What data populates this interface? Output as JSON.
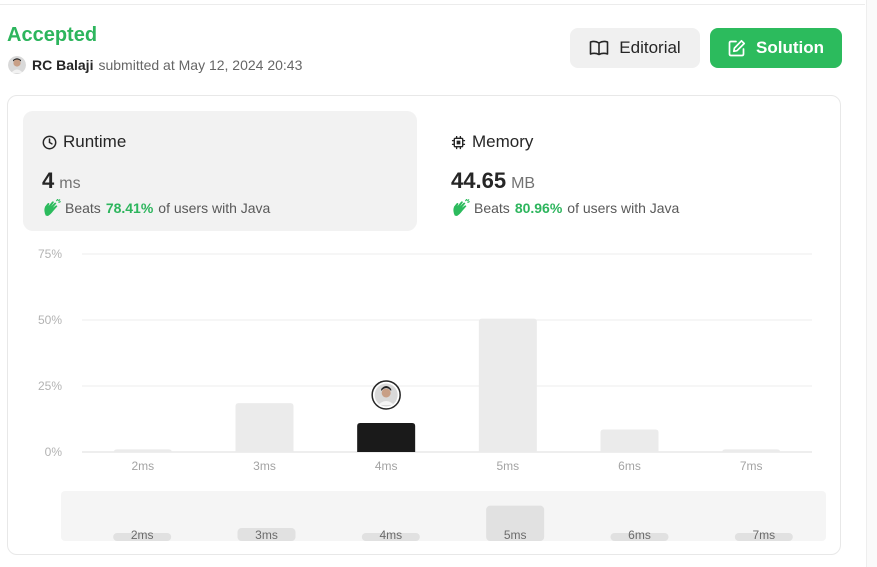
{
  "submission": {
    "status": "Accepted",
    "username": "RC Balaji",
    "submitted_text": "submitted at May 12, 2024 20:43"
  },
  "buttons": {
    "editorial": "Editorial",
    "solution": "Solution"
  },
  "runtime": {
    "title": "Runtime",
    "value": "4",
    "unit": "ms",
    "beats_label": "Beats",
    "beats_pct": "78.41%",
    "beats_suffix": "of users with Java"
  },
  "memory": {
    "title": "Memory",
    "value": "44.65",
    "unit": "MB",
    "beats_label": "Beats",
    "beats_pct": "80.96%",
    "beats_suffix": "of users with Java"
  },
  "colors": {
    "accent_green": "#2cbb5d",
    "bar": "#ebebeb",
    "highlight_bar": "#1a1a1a"
  },
  "chart_data": {
    "type": "bar",
    "categories": [
      "2ms",
      "3ms",
      "4ms",
      "5ms",
      "6ms",
      "7ms"
    ],
    "values": [
      1,
      18.5,
      11,
      50.5,
      8.5,
      1
    ],
    "highlight": "4ms",
    "ylim": [
      0,
      75
    ],
    "yticks": [
      0,
      25,
      50,
      75
    ],
    "ytick_labels": [
      "0%",
      "25%",
      "50%",
      "75%"
    ],
    "grid": true,
    "xlabel": "",
    "ylabel": ""
  }
}
